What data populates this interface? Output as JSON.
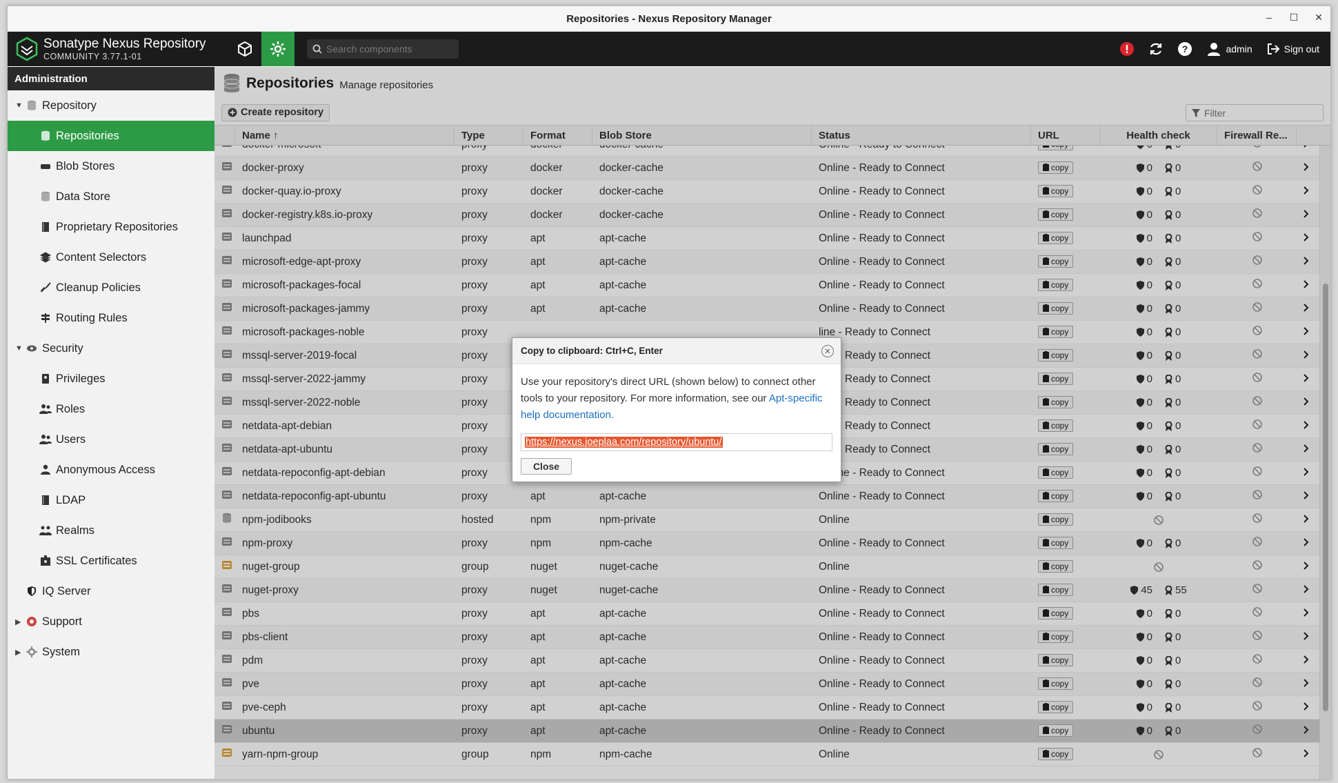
{
  "window": {
    "title": "Repositories - Nexus Repository Manager"
  },
  "header": {
    "brand_name": "Sonatype Nexus Repository",
    "brand_version": "COMMUNITY 3.77.1-01",
    "search_placeholder": "Search components",
    "user_label": "admin",
    "signout_label": "Sign out"
  },
  "sidebar": {
    "title": "Administration",
    "items": [
      {
        "label": "Repository",
        "level": 0,
        "expanded": true,
        "icon": "database-icon"
      },
      {
        "label": "Repositories",
        "level": 1,
        "active": true,
        "icon": "database-icon"
      },
      {
        "label": "Blob Stores",
        "level": 1,
        "icon": "storage-icon"
      },
      {
        "label": "Data Store",
        "level": 1,
        "icon": "database-icon"
      },
      {
        "label": "Proprietary Repositories",
        "level": 1,
        "icon": "book-icon"
      },
      {
        "label": "Content Selectors",
        "level": 1,
        "icon": "layers-icon"
      },
      {
        "label": "Cleanup Policies",
        "level": 1,
        "icon": "broom-icon"
      },
      {
        "label": "Routing Rules",
        "level": 1,
        "icon": "signpost-icon"
      },
      {
        "label": "Security",
        "level": 0,
        "expanded": true,
        "icon": "eye-icon"
      },
      {
        "label": "Privileges",
        "level": 1,
        "icon": "badge-icon"
      },
      {
        "label": "Roles",
        "level": 1,
        "icon": "users-icon"
      },
      {
        "label": "Users",
        "level": 1,
        "icon": "users-icon"
      },
      {
        "label": "Anonymous Access",
        "level": 1,
        "icon": "user-icon"
      },
      {
        "label": "LDAP",
        "level": 1,
        "icon": "book-icon"
      },
      {
        "label": "Realms",
        "level": 1,
        "icon": "realms-icon"
      },
      {
        "label": "SSL Certificates",
        "level": 1,
        "icon": "certificate-icon"
      },
      {
        "label": "IQ Server",
        "level": 0,
        "icon": "shield-icon"
      },
      {
        "label": "Support",
        "level": 0,
        "collapsed": true,
        "icon": "lifebuoy-icon"
      },
      {
        "label": "System",
        "level": 0,
        "collapsed": true,
        "icon": "gear-icon"
      }
    ]
  },
  "page": {
    "title": "Repositories",
    "subtitle": "Manage repositories",
    "create_label": "Create repository",
    "filter_placeholder": "Filter"
  },
  "grid": {
    "columns": [
      "Name ↑",
      "Type",
      "Format",
      "Blob Store",
      "Status",
      "URL",
      "Health check",
      "Firewall Re..."
    ],
    "copy_label": "copy",
    "rows": [
      {
        "name": "docker-microsoft",
        "type": "proxy",
        "format": "docker",
        "blob": "docker-cache",
        "status": "Online - Ready to Connect",
        "h1": "0",
        "h2": "0"
      },
      {
        "name": "docker-proxy",
        "type": "proxy",
        "format": "docker",
        "blob": "docker-cache",
        "status": "Online - Ready to Connect",
        "h1": "0",
        "h2": "0"
      },
      {
        "name": "docker-quay.io-proxy",
        "type": "proxy",
        "format": "docker",
        "blob": "docker-cache",
        "status": "Online - Ready to Connect",
        "h1": "0",
        "h2": "0"
      },
      {
        "name": "docker-registry.k8s.io-proxy",
        "type": "proxy",
        "format": "docker",
        "blob": "docker-cache",
        "status": "Online - Ready to Connect",
        "h1": "0",
        "h2": "0"
      },
      {
        "name": "launchpad",
        "type": "proxy",
        "format": "apt",
        "blob": "apt-cache",
        "status": "Online - Ready to Connect",
        "h1": "0",
        "h2": "0"
      },
      {
        "name": "microsoft-edge-apt-proxy",
        "type": "proxy",
        "format": "apt",
        "blob": "apt-cache",
        "status": "Online - Ready to Connect",
        "h1": "0",
        "h2": "0"
      },
      {
        "name": "microsoft-packages-focal",
        "type": "proxy",
        "format": "apt",
        "blob": "apt-cache",
        "status": "Online - Ready to Connect",
        "h1": "0",
        "h2": "0"
      },
      {
        "name": "microsoft-packages-jammy",
        "type": "proxy",
        "format": "apt",
        "blob": "apt-cache",
        "status": "Online - Ready to Connect",
        "h1": "0",
        "h2": "0"
      },
      {
        "name": "microsoft-packages-noble",
        "type": "proxy",
        "format": "",
        "blob": "",
        "status": "line - Ready to Connect",
        "h1": "0",
        "h2": "0"
      },
      {
        "name": "mssql-server-2019-focal",
        "type": "proxy",
        "format": "",
        "blob": "",
        "status": "line - Ready to Connect",
        "h1": "0",
        "h2": "0"
      },
      {
        "name": "mssql-server-2022-jammy",
        "type": "proxy",
        "format": "",
        "blob": "",
        "status": "line - Ready to Connect",
        "h1": "0",
        "h2": "0"
      },
      {
        "name": "mssql-server-2022-noble",
        "type": "proxy",
        "format": "",
        "blob": "",
        "status": "line - Ready to Connect",
        "h1": "0",
        "h2": "0"
      },
      {
        "name": "netdata-apt-debian",
        "type": "proxy",
        "format": "",
        "blob": "",
        "status": "line - Ready to Connect",
        "h1": "0",
        "h2": "0"
      },
      {
        "name": "netdata-apt-ubuntu",
        "type": "proxy",
        "format": "",
        "blob": "",
        "status": "line - Ready to Connect",
        "h1": "0",
        "h2": "0"
      },
      {
        "name": "netdata-repoconfig-apt-debian",
        "type": "proxy",
        "format": "apt",
        "blob": "apt-cache",
        "status": "Online - Ready to Connect",
        "h1": "0",
        "h2": "0"
      },
      {
        "name": "netdata-repoconfig-apt-ubuntu",
        "type": "proxy",
        "format": "apt",
        "blob": "apt-cache",
        "status": "Online - Ready to Connect",
        "h1": "0",
        "h2": "0"
      },
      {
        "name": "npm-jodibooks",
        "type": "hosted",
        "format": "npm",
        "blob": "npm-private",
        "status": "Online",
        "h1": "",
        "h2": ""
      },
      {
        "name": "npm-proxy",
        "type": "proxy",
        "format": "npm",
        "blob": "npm-cache",
        "status": "Online - Ready to Connect",
        "h1": "0",
        "h2": "0"
      },
      {
        "name": "nuget-group",
        "type": "group",
        "format": "nuget",
        "blob": "nuget-cache",
        "status": "Online",
        "h1": "",
        "h2": ""
      },
      {
        "name": "nuget-proxy",
        "type": "proxy",
        "format": "nuget",
        "blob": "nuget-cache",
        "status": "Online - Ready to Connect",
        "h1": "45",
        "h2": "55"
      },
      {
        "name": "pbs",
        "type": "proxy",
        "format": "apt",
        "blob": "apt-cache",
        "status": "Online - Ready to Connect",
        "h1": "0",
        "h2": "0"
      },
      {
        "name": "pbs-client",
        "type": "proxy",
        "format": "apt",
        "blob": "apt-cache",
        "status": "Online - Ready to Connect",
        "h1": "0",
        "h2": "0"
      },
      {
        "name": "pdm",
        "type": "proxy",
        "format": "apt",
        "blob": "apt-cache",
        "status": "Online - Ready to Connect",
        "h1": "0",
        "h2": "0"
      },
      {
        "name": "pve",
        "type": "proxy",
        "format": "apt",
        "blob": "apt-cache",
        "status": "Online - Ready to Connect",
        "h1": "0",
        "h2": "0"
      },
      {
        "name": "pve-ceph",
        "type": "proxy",
        "format": "apt",
        "blob": "apt-cache",
        "status": "Online - Ready to Connect",
        "h1": "0",
        "h2": "0"
      },
      {
        "name": "ubuntu",
        "type": "proxy",
        "format": "apt",
        "blob": "apt-cache",
        "status": "Online - Ready to Connect",
        "h1": "0",
        "h2": "0",
        "selected": true
      },
      {
        "name": "yarn-npm-group",
        "type": "group",
        "format": "npm",
        "blob": "npm-cache",
        "status": "Online",
        "h1": "",
        "h2": ""
      }
    ]
  },
  "dialog": {
    "title": "Copy to clipboard: Ctrl+C, Enter",
    "body_text": "Use your repository's direct URL (shown below) to connect other tools to your repository. For more information, see our ",
    "link_text": "Apt-specific help documentation.",
    "url": "https://nexus.joeplaa.com/repository/ubuntu/",
    "close_label": "Close"
  },
  "colors": {
    "accent": "#2d9b46",
    "header_bg": "#1b1b1b",
    "selection": "#e4572e",
    "alert": "#d9232e"
  }
}
